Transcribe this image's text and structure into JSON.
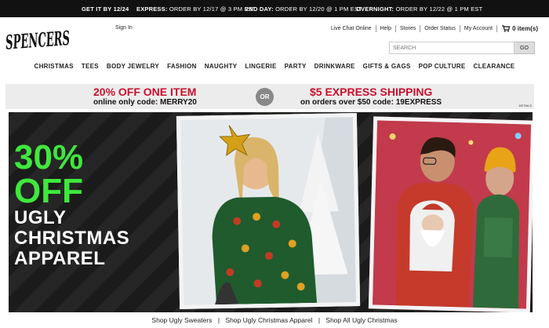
{
  "topbar": {
    "get_it_by": "GET IT BY 12/24",
    "express_label": "EXPRESS:",
    "express_text": "ORDER BY 12/17 @ 3 PM EST",
    "twoday_label": "2ND DAY:",
    "twoday_text": "ORDER BY 12/20 @ 1 PM EST",
    "overnight_label": "OVERNIGHT:",
    "overnight_text": "ORDER BY 12/22 @ 1 PM EST"
  },
  "header": {
    "logo_text": "SPENCERS",
    "sign_in": "Sign In",
    "utility": [
      "Live Chat Online",
      "Help",
      "Stores",
      "Order Status",
      "My Account"
    ],
    "cart_label": "0 item(s)",
    "search_placeholder": "SEARCH",
    "search_button": "GO"
  },
  "nav": {
    "items": [
      "CHRISTMAS",
      "TEES",
      "BODY JEWELRY",
      "FASHION",
      "NAUGHTY",
      "LINGERIE",
      "PARTY",
      "DRINKWARE",
      "GIFTS & GAGS",
      "POP CULTURE",
      "CLEARANCE"
    ]
  },
  "promo": {
    "offer1_title": "20% OFF ONE ITEM",
    "offer1_detail": "online only  code: MERRY20",
    "or": "OR",
    "offer2_title": "$5 EXPRESS SHIPPING",
    "offer2_detail": "on orders over $50  code: 19EXPRESS",
    "details_link": "DETAILS"
  },
  "hero": {
    "line1": "30%",
    "line2": "OFF",
    "line3": "UGLY",
    "line4": "CHRISTMAS",
    "line5": "APPAREL"
  },
  "links": {
    "items": [
      "Shop Ugly Sweaters",
      "Shop Ugly Christmas Apparel",
      "Shop All Ugly Christmas"
    ],
    "separator": "|"
  },
  "colors": {
    "accent_red": "#c8102e",
    "hero_green": "#3fe83c",
    "topbar_bg": "#111111"
  }
}
